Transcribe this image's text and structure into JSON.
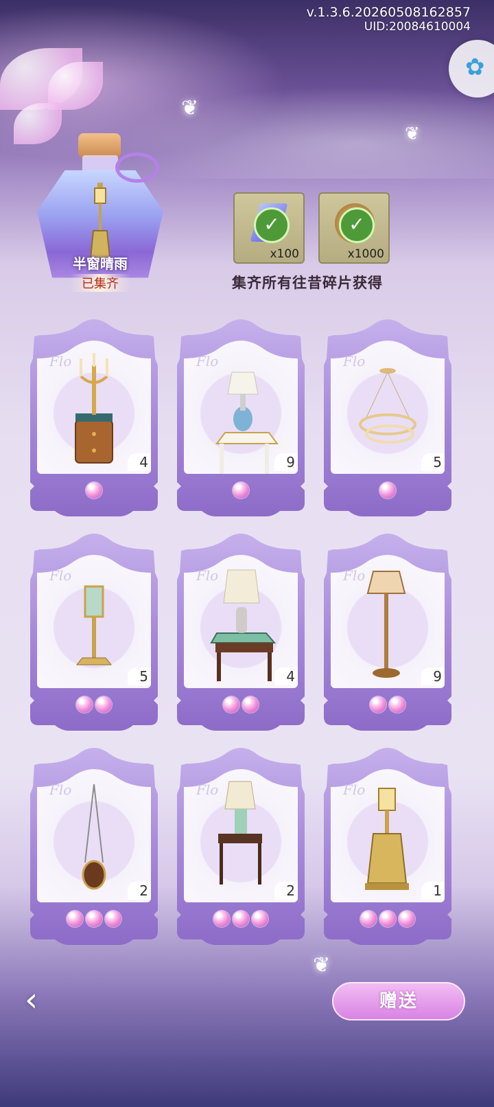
{
  "header": {
    "version": "v.1.3.6.20260508162857",
    "uid": "UID:20084610004"
  },
  "collection": {
    "name": "半窗晴雨",
    "status": "已集齐"
  },
  "rewards": {
    "items": [
      {
        "icon": "feather-gem-icon",
        "qty": "x100",
        "claimed": true
      },
      {
        "icon": "coin-icon",
        "qty": "x1000",
        "claimed": true
      }
    ],
    "caption": "集齐所有往昔碎片获得"
  },
  "cards": [
    {
      "item": "candelabra-nightstand",
      "count": "4",
      "pearls": 1
    },
    {
      "item": "table-lamp-white-stand",
      "count": "9",
      "pearls": 1
    },
    {
      "item": "ring-chandelier",
      "count": "5",
      "pearls": 1
    },
    {
      "item": "lantern-floor-lamp",
      "count": "5",
      "pearls": 2
    },
    {
      "item": "table-lamp-carved-table",
      "count": "4",
      "pearls": 2
    },
    {
      "item": "brass-floor-lamp",
      "count": "9",
      "pearls": 2
    },
    {
      "item": "hanging-lantern",
      "count": "2",
      "pearls": 3
    },
    {
      "item": "shade-lamp-side-table",
      "count": "2",
      "pearls": 3
    },
    {
      "item": "golden-lamp-pedestal",
      "count": "1",
      "pearls": 3
    }
  ],
  "footer": {
    "back_icon": "back-arrow-icon",
    "gift_label": "赠送"
  },
  "colors": {
    "card_purple": "#a487d8",
    "pearl_pink": "#ee8bd9",
    "status_red": "#b02d1a"
  }
}
